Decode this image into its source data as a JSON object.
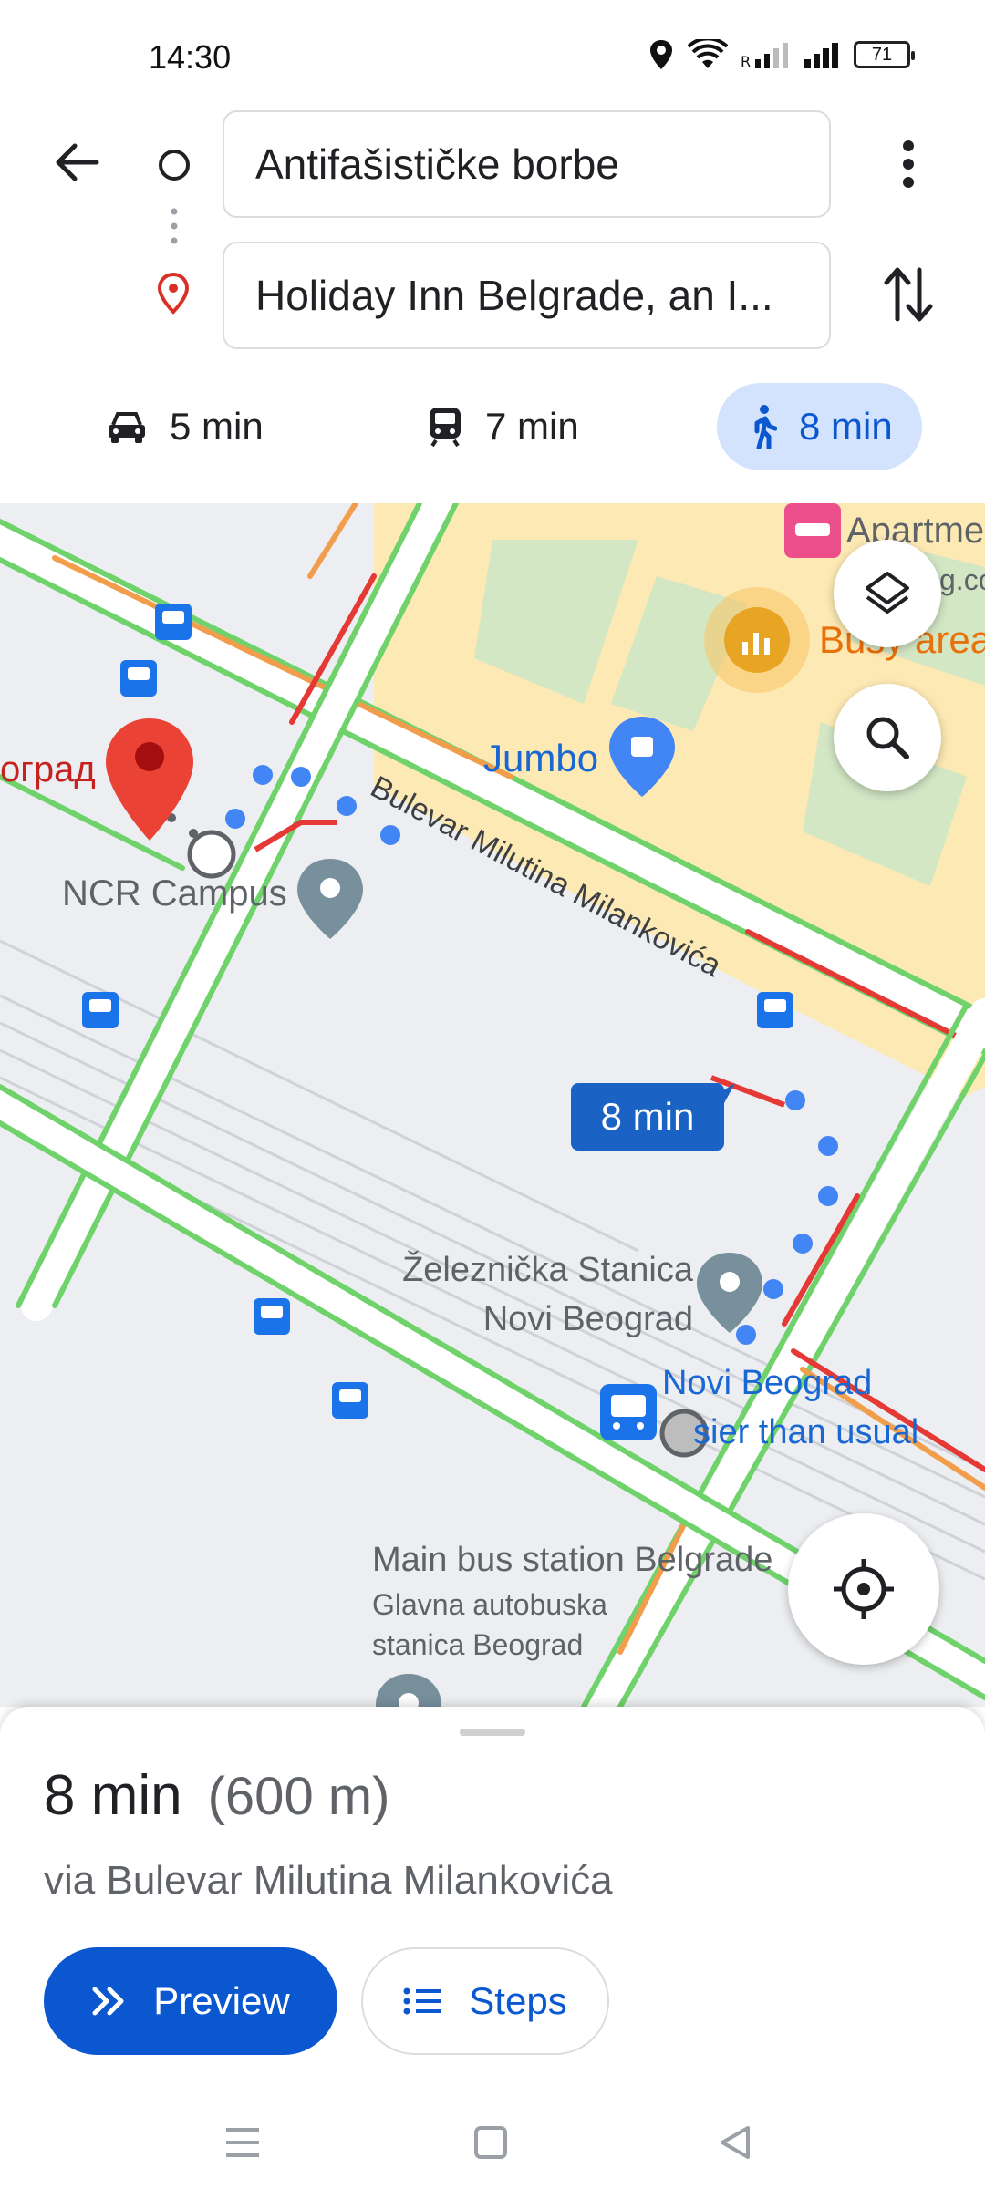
{
  "status_bar": {
    "time": "14:30",
    "battery": "71"
  },
  "directions": {
    "origin": "Antifašističke borbe",
    "destination": "Holiday Inn Belgrade, an I..."
  },
  "modes": [
    {
      "name": "car",
      "time": "5 min"
    },
    {
      "name": "transit",
      "time": "7 min"
    },
    {
      "name": "walk",
      "time": "8 min",
      "selected": true
    }
  ],
  "map": {
    "labels": {
      "place_partial": "оград",
      "ncr": "NCR Campus",
      "jumbo": "Jumbo",
      "busy": "Busy area",
      "apartment": "Apartme",
      "apartment_2": "g.co",
      "street": "Bulevar Milutina Milankovića",
      "station_1": "Železnička Stanica",
      "station_2": "Novi Beograd",
      "stop_name": "Novi Beograd",
      "stop_note": "sier than usual",
      "bus_station": "Main bus station Belgrade",
      "bus_station_sub_1": "Glavna autobuska",
      "bus_station_sub_2": "stanica Beograd"
    },
    "route_bubble": "8 min"
  },
  "sheet": {
    "duration": "8 min",
    "distance": "(600 m)",
    "via": "via Bulevar Milutina Milankovića",
    "preview_label": "Preview",
    "steps_label": "Steps"
  },
  "colors": {
    "accent": "#0b57d0",
    "route": "#4285f4",
    "traffic_green": "#6fd26b",
    "traffic_orange": "#f29d4b",
    "traffic_red": "#e53935",
    "commercial": "#fde9b4",
    "pin_red": "#ea4335"
  }
}
